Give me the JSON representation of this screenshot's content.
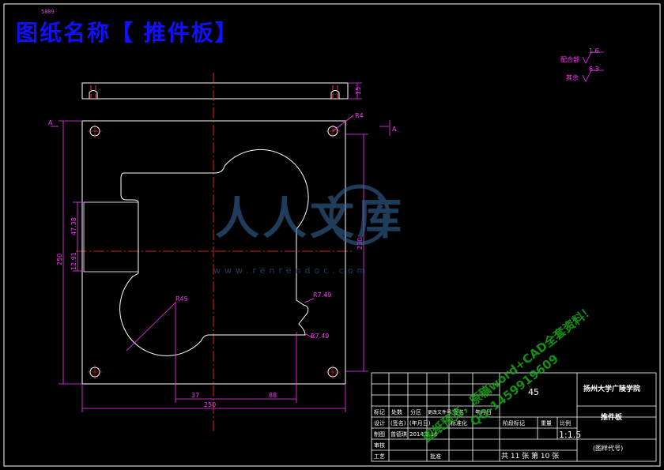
{
  "page_title": "图纸名称【  推件板】",
  "corner_tag": "5009",
  "roughness": {
    "mating_label": "配合部",
    "mating_value": "1.6",
    "other_label": "其余",
    "other_value": "6.3"
  },
  "dimensions": {
    "total_width": "250",
    "total_height": "250",
    "inner_height": "230",
    "left_upper": "47.38",
    "left_lower": "12.91",
    "bottom_left": "37",
    "bottom_right": "88",
    "radius_corner": "R4",
    "radius_large": "R45",
    "radius_upper": "R7.49",
    "radius_lower": "R7.49",
    "thickness": "15"
  },
  "section_marks": {
    "left": "A",
    "right": "A"
  },
  "watermark": {
    "cn": "人人文库",
    "url": "www.renrendoc.com",
    "promo_1": "图纸预览，原稿word+CAD全套资料！",
    "promo_2": "QQ-1459919609"
  },
  "title_block": {
    "material": "45",
    "school": "扬州大学广陵学院",
    "part_name": "推件板",
    "part_code": "(图样代号)",
    "scale_label": "比例",
    "scale_value": "1:1.5",
    "weight_label": "重量",
    "stage_label": "阶段标记",
    "sheets": "共 11 张 第 10 张",
    "row_mark": "标记",
    "row_count": "处数",
    "row_zone": "分区",
    "row_doc": "更改文件号",
    "row_sign": "签名",
    "row_date": "年月日",
    "design_label": "设计",
    "design_sign": "(签名)",
    "design_date": "(年月日)",
    "std_label": "标准化",
    "check_label": "审核",
    "craft_label": "工艺",
    "approve_label": "批准",
    "draft_label": "制图",
    "draft_name": "曾德琪",
    "draft_date": "2014.5.16"
  },
  "colors": {
    "outline": "#ffffff",
    "dimension": "#ff33ff",
    "centerline": "#ff3333",
    "title": "#1010ff",
    "promo": "#18a818",
    "watermark": "#3a6ea5"
  }
}
